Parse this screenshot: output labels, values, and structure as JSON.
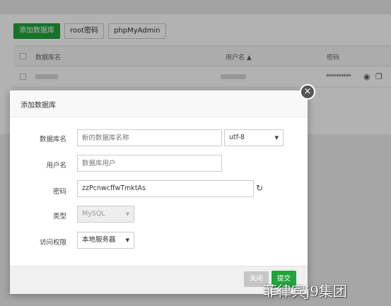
{
  "toolbar": {
    "add_db_label": "添加数据库",
    "root_pw_label": "root密码",
    "phpmyadmin_label": "phpMyAdmin"
  },
  "table": {
    "headers": [
      "数据库名",
      "用户名 ▲",
      "密码"
    ],
    "rows": [
      {
        "password_mask": "**********"
      }
    ]
  },
  "modal": {
    "title": "添加数据库",
    "close_glyph": "×",
    "fields": {
      "dbname_label": "数据库名",
      "dbname_placeholder": "新的数据库名称",
      "charset_value": "utf-8",
      "username_label": "用户名",
      "username_placeholder": "数据库用户",
      "password_label": "密码",
      "password_value": "zzPcnwcffwTmktAs",
      "type_label": "类型",
      "type_value": "MySQL",
      "access_label": "访问权限",
      "access_value": "本地服务器"
    },
    "footer": {
      "close_label": "关闭",
      "submit_label": "提交"
    }
  },
  "watermark": "菲律宾j9集团",
  "colors": {
    "accent_green": "#20a53a",
    "overlay": "rgba(0,0,0,0.30)"
  },
  "icons": {
    "caret": "caret-down-icon",
    "refresh": "refresh-icon",
    "eye": "eye-icon",
    "copy": "copy-icon",
    "close": "close-icon"
  }
}
